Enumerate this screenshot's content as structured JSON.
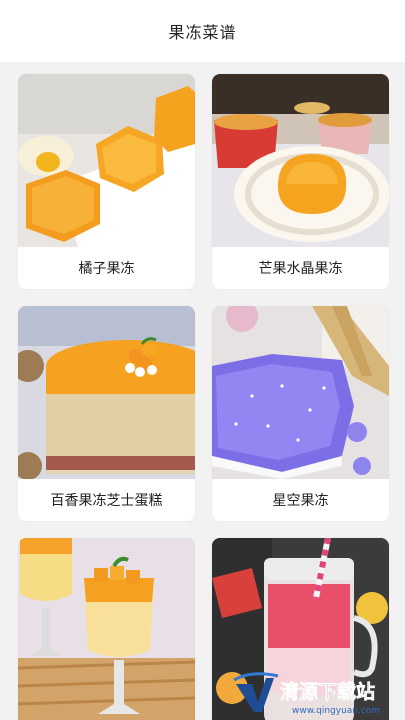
{
  "header": {
    "title": "果冻菜谱"
  },
  "recipes": [
    {
      "name": "橘子果冻"
    },
    {
      "name": "芒果水晶果冻"
    },
    {
      "name": "百香果冻芝士蛋糕"
    },
    {
      "name": "星空果冻"
    },
    {
      "name": ""
    },
    {
      "name": ""
    }
  ],
  "watermark": {
    "text": "清源下载站",
    "url": "www.qingyuan.com"
  }
}
